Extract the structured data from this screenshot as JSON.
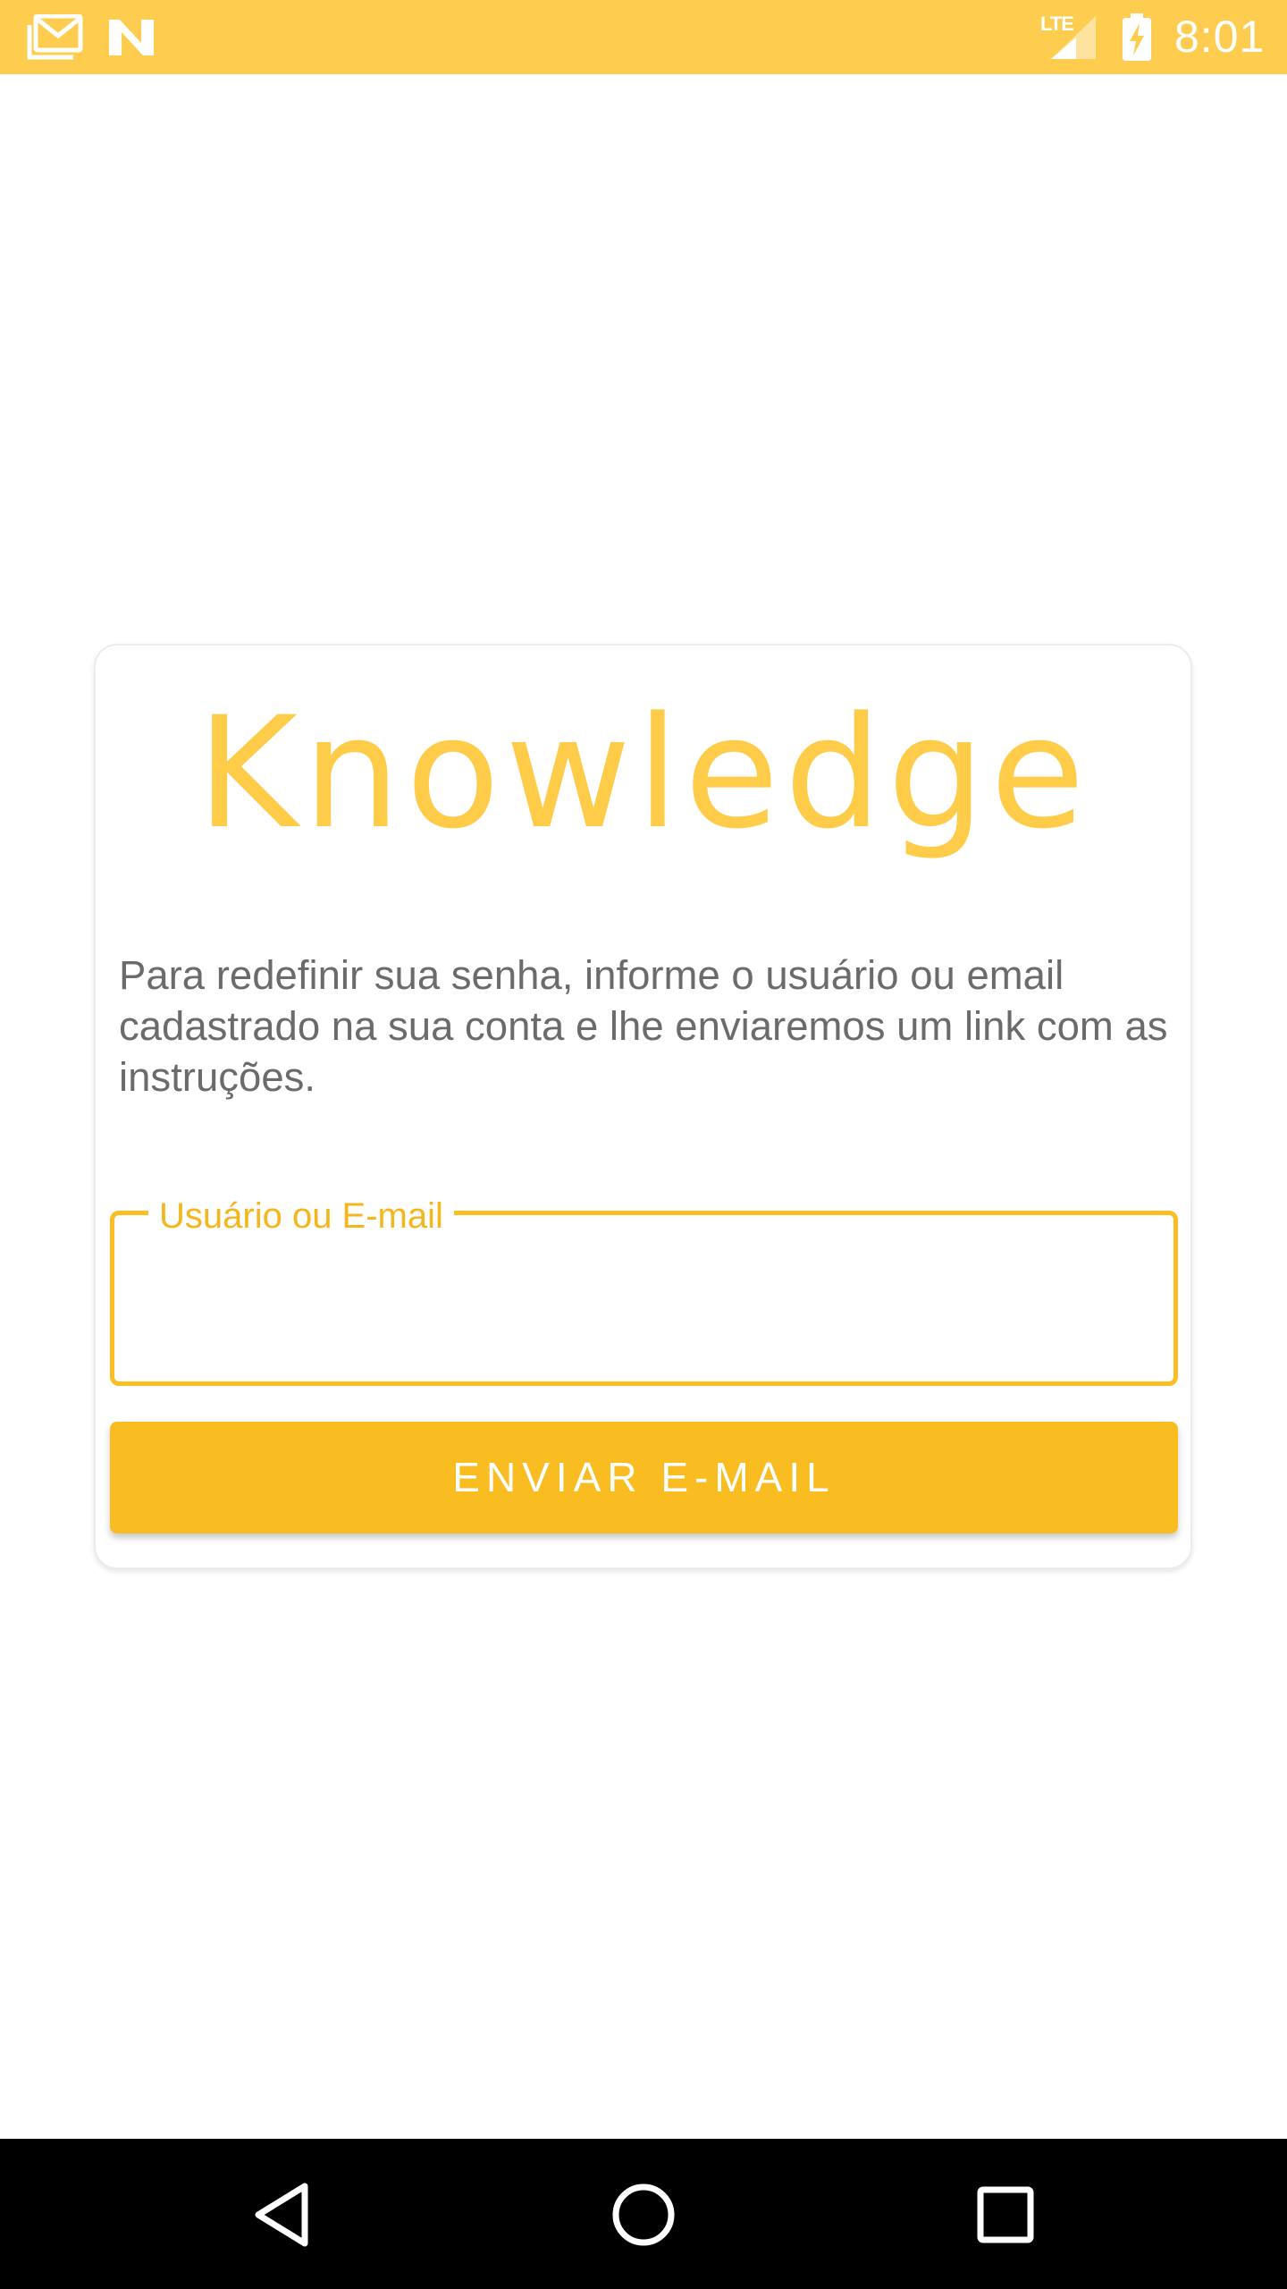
{
  "status_bar": {
    "time": "8:01",
    "network_label": "LTE",
    "icons": [
      "gmail-icon",
      "n-notification-icon",
      "signal-icon",
      "battery-charging-icon"
    ],
    "background_color": "#FECD4F"
  },
  "card": {
    "app_title": "Knowledge",
    "instructions": "Para redefinir sua senha, informe o usuário ou email cadastrado na sua conta e lhe enviaremos um link com as instruções.",
    "input": {
      "label": "Usuário ou E-mail",
      "value": ""
    },
    "send_button_label": "ENVIAR E-MAIL",
    "accent_color": "#F9BD22"
  },
  "nav_bar": {
    "icons": [
      "back-icon",
      "home-icon",
      "recents-icon"
    ]
  }
}
